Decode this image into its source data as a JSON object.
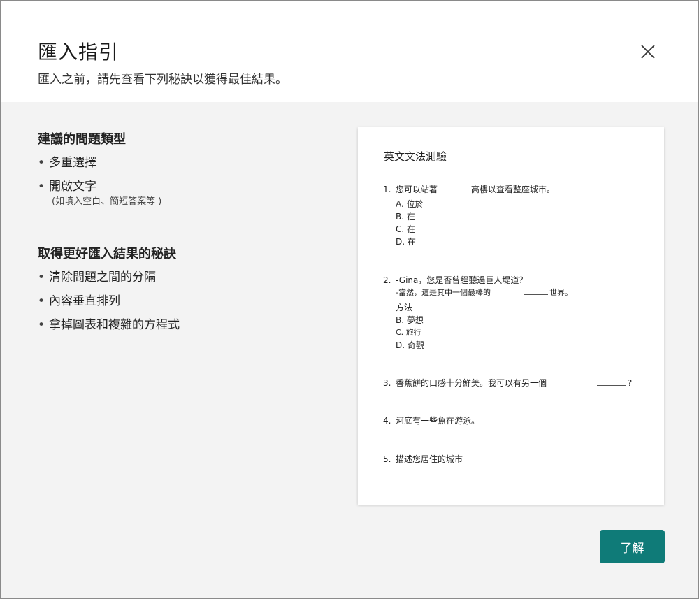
{
  "dialog": {
    "title": "匯入指引",
    "subtitle": "匯入之前，請先查看下列秘訣以獲得最佳結果。",
    "close_icon": "close-icon"
  },
  "left": {
    "section1_title": "建議的問題類型",
    "section1_items": [
      "多重選擇",
      "開啟文字"
    ],
    "section1_note": "(如填入空白、簡短答案等 )",
    "section2_title": "取得更好匯入結果的秘訣",
    "section2_items": [
      "清除問題之間的分隔",
      "內容垂直排列",
      "拿掉圖表和複雜的方程式"
    ]
  },
  "preview": {
    "title": "英文文法測驗",
    "q1": {
      "num": "1.",
      "before": "您可以站著",
      "after": "高樓以查看整座城市。",
      "options": [
        "A. 位於",
        "B. 在",
        "C. 在",
        "D. 在"
      ]
    },
    "q2": {
      "num": "2.",
      "line1": "-Gina，您是否曾經聽過巨人堤道？",
      "line2_before": "-當然，這是其中一個最棒的",
      "line2_after": "世界。",
      "options": [
        "方法",
        "B. 夢想",
        "C. 旅行",
        "D. 奇觀"
      ]
    },
    "q3": {
      "num": "3.",
      "text": "香蕉餅的口感十分鮮美。我可以有另一個",
      "after": "?"
    },
    "q4": {
      "num": "4.",
      "text": "河底有一些魚在游泳。"
    },
    "q5": {
      "num": "5.",
      "text": "描述您居住的城市"
    }
  },
  "buttons": {
    "ok_label": "了解"
  },
  "colors": {
    "accent": "#0f7b78",
    "panel_bg": "#f3f3f3"
  }
}
